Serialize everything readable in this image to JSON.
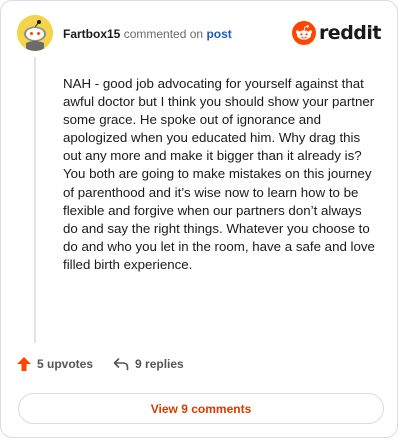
{
  "comment": {
    "author": "Fartbox15",
    "commented_on_text": "commented on",
    "post_link_text": "post",
    "body": "NAH - good job advocating for yourself against that awful doctor but I think you should show your partner some grace. He spoke out of ignorance and apologized when you educated him. Why drag this out any more and make it bigger than it already is? You both are going to make mistakes on this journey of parenthood and it’s wise now to learn how to be flexible and forgive when our partners don’t always do and say the right things. Whatever you choose to do and who you let in the room, have a safe and love filled birth experience."
  },
  "brand": {
    "wordmark": "reddit",
    "icon": "reddit-snoo-icon",
    "color": "#ff4500"
  },
  "actions": {
    "upvotes_label": "5 upvotes",
    "replies_label": "9 replies",
    "upvote_icon": "upvote-arrow-icon",
    "reply_icon": "reply-arrow-icon",
    "upvote_color": "#ff4500"
  },
  "footer": {
    "view_comments_label": "View 9 comments",
    "accent": "#d93a00"
  }
}
